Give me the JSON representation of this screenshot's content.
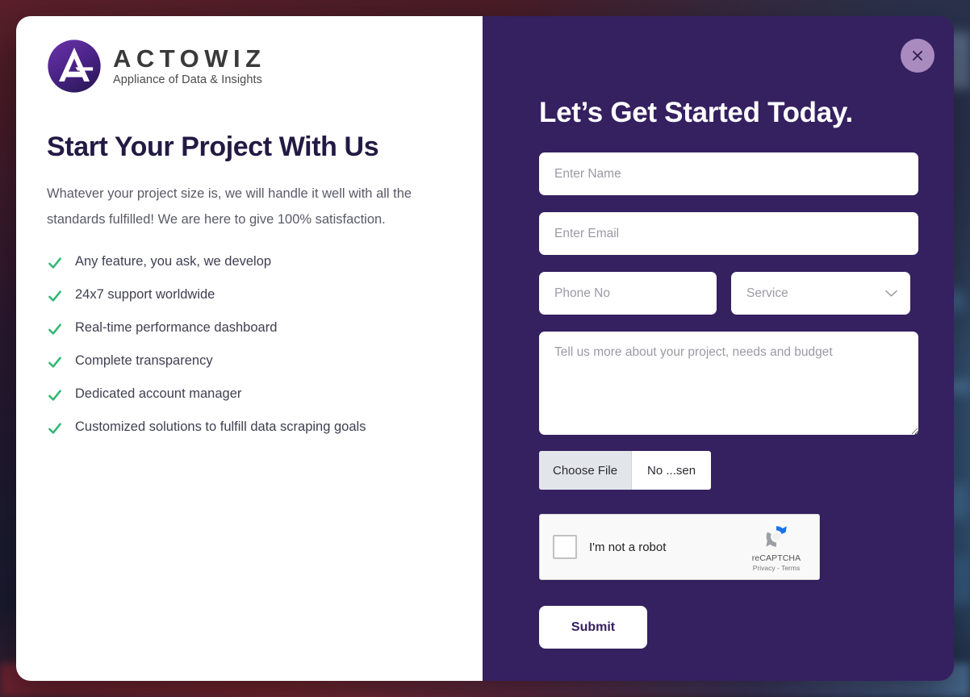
{
  "brand": {
    "name": "ACTOWIZ",
    "tagline": "Appliance of Data & Insights",
    "logo_icon": "actowiz-a-circle-logo",
    "mark_color": "#5b2d91",
    "mark_color_dark": "#3b1f6b"
  },
  "left": {
    "title": "Start Your Project With Us",
    "subtitle": "Whatever your project size is, we will handle it well with all the standards fulfilled! We are here to give 100% satisfaction.",
    "check_icon": "check-icon",
    "check_color": "#2eb872",
    "features": [
      "Any feature, you ask, we develop",
      "24x7 support worldwide",
      "Real-time performance dashboard",
      "Complete transparency",
      "Dedicated account manager",
      "Customized solutions to fulfill data scraping goals"
    ]
  },
  "right": {
    "panel_color": "#352060",
    "close_icon": "close-x-icon",
    "close_bg": "#a98bc0",
    "title": "Let’s Get Started Today.",
    "form": {
      "name_placeholder": "Enter Name",
      "name_value": "",
      "email_placeholder": "Enter Email",
      "email_value": "",
      "phone_placeholder": "Phone No",
      "phone_value": "",
      "service_placeholder": "Service",
      "service_value": "",
      "service_caret_icon": "chevron-down-icon",
      "message_placeholder": "Tell us more about your project, needs and budget",
      "message_value": "",
      "file_button_label": "Choose File",
      "file_status": "No ...sen",
      "submit_label": "Submit"
    },
    "recaptcha": {
      "label": "I'm not a robot",
      "brand": "reCAPTCHA",
      "links": "Privacy - Terms",
      "logo_icon": "recaptcha-logo-icon",
      "checkbox_icon": "checkbox-unchecked"
    }
  }
}
